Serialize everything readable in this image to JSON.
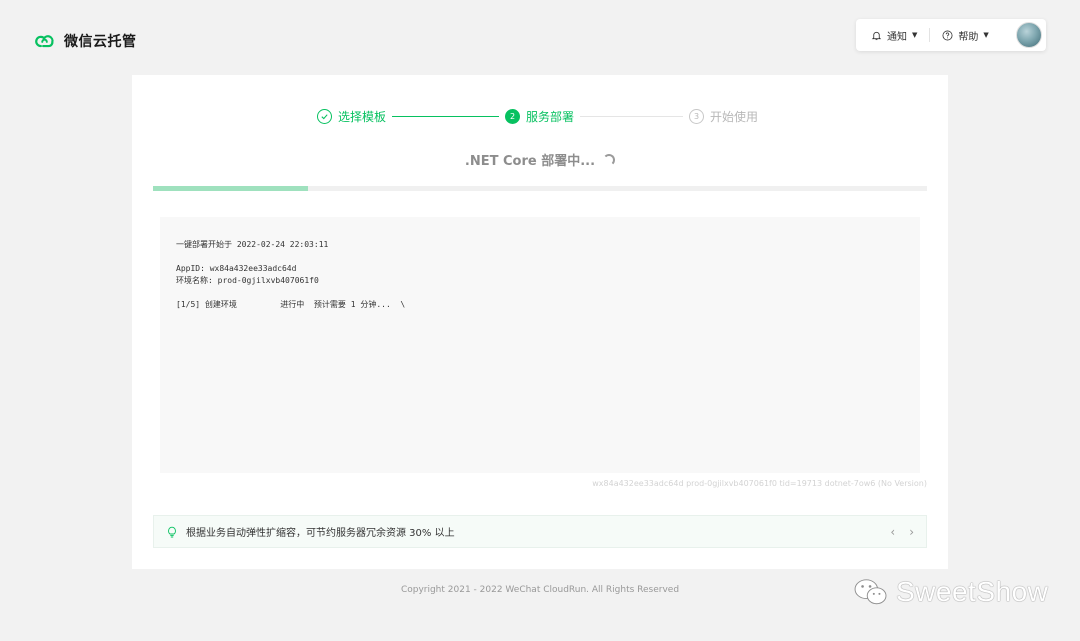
{
  "brand": {
    "name": "微信云托管"
  },
  "topbar": {
    "notify_label": "通知",
    "help_label": "帮助"
  },
  "steps": [
    {
      "index": "1",
      "label": "选择模板",
      "state": "done"
    },
    {
      "index": "2",
      "label": "服务部署",
      "state": "active"
    },
    {
      "index": "3",
      "label": "开始使用",
      "state": "pending"
    }
  ],
  "deploy": {
    "title": ".NET Core 部署中...",
    "progress_percent": 20
  },
  "log": {
    "start_line": "一键部署开始于 2022-02-24 22:03:11",
    "appid_line": "AppID: wx84a432ee33adc64d",
    "env_line": "环境名称: prod-0gjilxvb407061f0",
    "step_line": "[1/5] 创建环境         进行中  预计需要 1 分钟...  \\"
  },
  "meta_text": "wx84a432ee33adc64d prod-0gjilxvb407061f0 tid=19713 dotnet-7ow6 (No Version)",
  "tip": {
    "text": "根据业务自动弹性扩缩容，可节约服务器冗余资源 30% 以上",
    "prev": "‹",
    "next": "›"
  },
  "footer": {
    "copyright": "Copyright 2021 - 2022 WeChat CloudRun. All Rights Reserved"
  },
  "watermark": {
    "text": "SweetShow"
  },
  "colors": {
    "accent": "#07c160",
    "progress_fill": "#9fe1be",
    "pending": "#b8b8b8"
  }
}
